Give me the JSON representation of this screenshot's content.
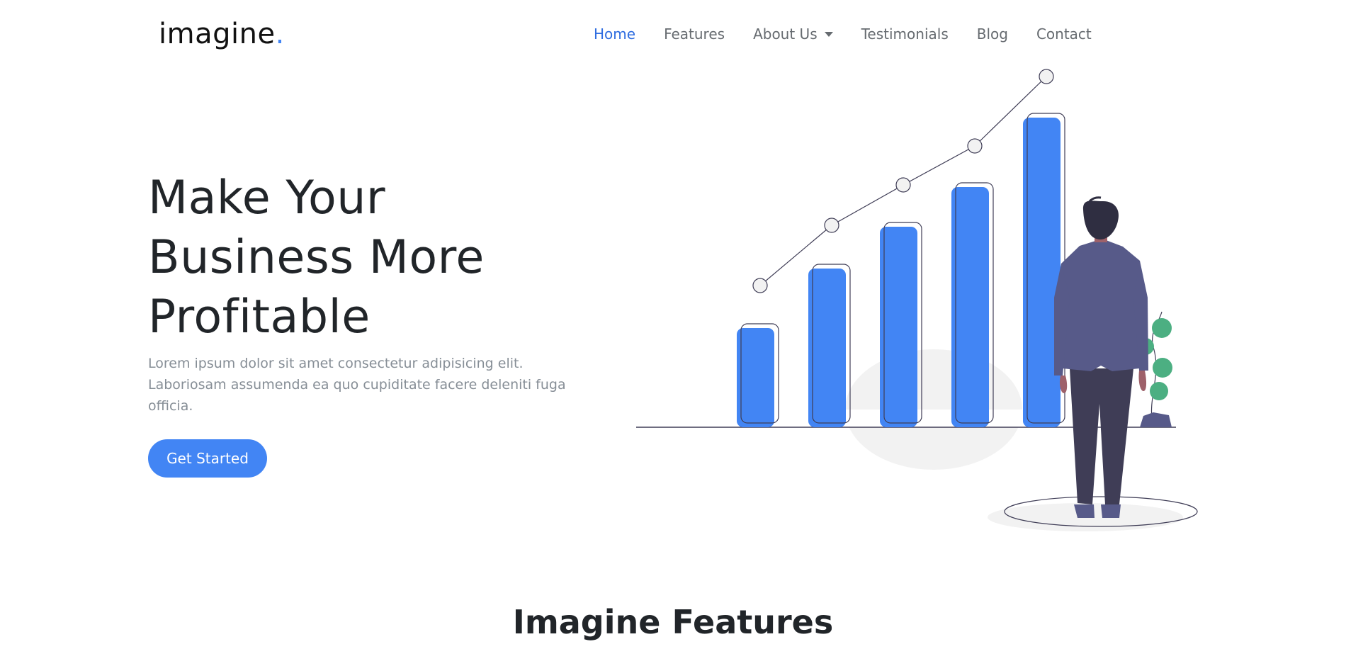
{
  "brand": {
    "name": "imagine",
    "dot": "."
  },
  "nav": {
    "items": [
      {
        "label": "Home"
      },
      {
        "label": "Features"
      },
      {
        "label": "About Us"
      },
      {
        "label": "Testimonials"
      },
      {
        "label": "Blog"
      },
      {
        "label": "Contact"
      }
    ],
    "active": "Home"
  },
  "hero": {
    "title_lines": [
      "Make Your",
      "Business More",
      "Profitable"
    ],
    "text": "Lorem ipsum dolor sit amet consectetur adipisicing elit. Laboriosam assumenda ea quo cupiditate facere deleniti fuga officia.",
    "cta_label": "Get Started"
  },
  "features": {
    "title": "Imagine Features"
  },
  "colors": {
    "accent": "#4285f4",
    "nav_active": "#2f6de0",
    "text_muted": "#868e96",
    "suit": "#575a89",
    "trousers": "#3f3d56",
    "plant": "#4caf82"
  },
  "icons": {
    "dropdown": "caret-down-icon"
  }
}
